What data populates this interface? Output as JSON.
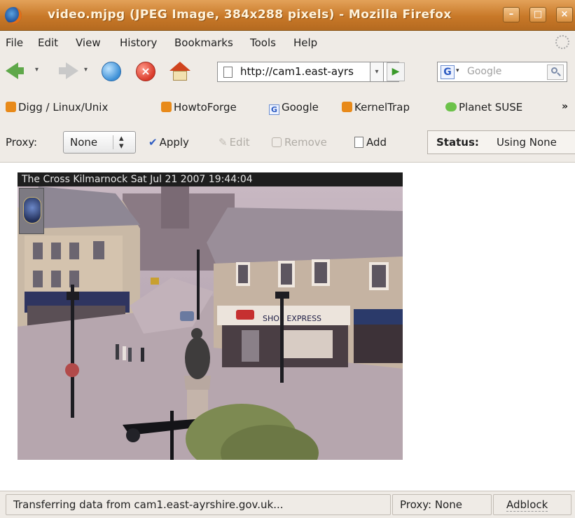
{
  "window": {
    "title": "video.mjpg (JPEG Image, 384x288 pixels) - Mozilla Firefox",
    "minimize": "–",
    "maximize": "□",
    "close": "×"
  },
  "menubar": {
    "items": [
      "File",
      "Edit",
      "View",
      "History",
      "Bookmarks",
      "Tools",
      "Help"
    ]
  },
  "navigation": {
    "url": "http://cam1.east-ayrs",
    "search_engine_icon": "G",
    "search_placeholder": "Google",
    "icons": [
      "back-icon",
      "forward-icon",
      "reload-icon",
      "stop-icon",
      "home-icon",
      "go-icon",
      "search-icon"
    ]
  },
  "bookmarks": {
    "items": [
      "Digg / Linux/Unix",
      "HowtoForge",
      "Google",
      "KernelTrap",
      "Planet SUSE"
    ],
    "overflow": "»"
  },
  "proxy_toolbar": {
    "label": "Proxy:",
    "selected": "None",
    "apply": "Apply",
    "edit": "Edit",
    "remove": "Remove",
    "add": "Add",
    "status_label": "Status:",
    "status_value": "Using None"
  },
  "content": {
    "camera_caption": "The Cross Kilmarnock Sat Jul 21 2007 19:44:04",
    "shop_sign": "SHOE EXPRESS"
  },
  "statusbar": {
    "message": "Transferring data from cam1.east-ayrshire.gov.uk...",
    "proxy": "Proxy: None",
    "adblock": "Adblock"
  }
}
